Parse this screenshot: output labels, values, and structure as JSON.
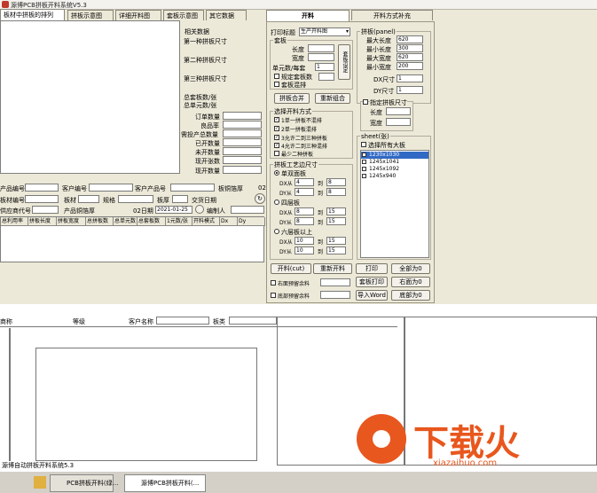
{
  "window": {
    "title": "源博PCB拼板开料系统V5.3"
  },
  "left_tabs": [
    "板材中拼板的排列",
    "拼板示意图",
    "详细开料图",
    "套板示意图",
    "其它数据"
  ],
  "related": {
    "title": "相关数据",
    "first": "第一种拼板尺寸",
    "second": "第二种拼板尺寸",
    "third": "第三种拼板尺寸",
    "total_sets": "总套板数/张",
    "total_units": "总单元数/张",
    "rows": [
      "订单数量",
      "良品率",
      "需投产总数量",
      "已开数量",
      "未开数量",
      "现开张数",
      "现开数量"
    ]
  },
  "info": {
    "product_no": "产品编号",
    "customer_no": "客户编号",
    "customer_product": "客户产品号",
    "board_thick": "板铜箔厚",
    "material_no": "板材编号",
    "material": "板材",
    "spec": "规格",
    "board_thick2": "板厚",
    "delivery": "交货日期",
    "supplier": "供应商代号",
    "product_foil": "产品铜箔厚",
    "date_label": "02日期",
    "date": "2021-01-25",
    "editor": "编制人",
    "val_02": "02"
  },
  "table_headers": [
    "总利用率",
    "拼板长度",
    "拼板宽度",
    "总拼板数",
    "总单元数",
    "总套板数",
    "1元数/张",
    "开料模式",
    "Dx",
    "Dy"
  ],
  "right_tabs": {
    "cut": "开料",
    "method": "开料方式补充"
  },
  "print_label": "打印标题",
  "print_value": "生产开料图",
  "set": {
    "title": "套板",
    "length": "长度",
    "width": "宽度",
    "units_label": "单元数/每套",
    "units": "1",
    "fixed_count": "规定套板数",
    "mixed": "套板混排",
    "side_btn": "套板设定",
    "merge": "拼板合并",
    "recombine": "重新组合"
  },
  "method": {
    "title": "选择开料方式",
    "opts": [
      "1单一拼板不混排",
      "2单一拼板混排",
      "3允许二到三种拼板",
      "4允许二到三种混排",
      "最少二种拼板"
    ]
  },
  "edge": {
    "title": "拼板工艺边尺寸",
    "two": "单双面板",
    "four": "四层板",
    "six": "六层板以上",
    "dx": "DX从",
    "dy": "DY从",
    "to": "到",
    "vals": [
      [
        "4",
        "8"
      ],
      [
        "4",
        "8"
      ],
      [
        "8",
        "15"
      ],
      [
        "8",
        "15"
      ],
      [
        "10",
        "15"
      ],
      [
        "10",
        "15"
      ]
    ]
  },
  "panel": {
    "title": "拼板(panel)",
    "max_len": "最大长度",
    "min_len": "最小长度",
    "max_wid": "最大宽度",
    "min_wid": "最小宽度",
    "dx": "DX尺寸",
    "dy": "DY尺寸",
    "vals": [
      "620",
      "300",
      "620",
      "200",
      "1",
      "1"
    ],
    "fixed": "指定拼板尺寸",
    "len": "长度",
    "wid": "宽度"
  },
  "sheet": {
    "title": "sheet(张)",
    "all": "选择所有大板",
    "items": [
      "1230x1030",
      "1245x1041",
      "1245x1092",
      "1245x940"
    ]
  },
  "buttons": {
    "cut": "开料(cut)",
    "recut": "重新开料",
    "print": "打印",
    "all_to": "全部为0",
    "print_set": "套板打印",
    "right_to": "右面为0",
    "export": "导入Word",
    "bottom_to": "底部为0",
    "right_keep": "右面预留余料",
    "bottom_keep": "底部预留余料"
  },
  "lower": {
    "name": "商称",
    "grade": "等级",
    "customer_name": "客户名称",
    "board_type": "板类"
  },
  "status": "源博自动拼板开料系统5.3",
  "taskbar": {
    "t1": "PCB拼板开料(绿...",
    "t2": "源博PCB拼板开料(..."
  },
  "watermark": {
    "text": "下载火",
    "url": "xiazaihuo.com"
  }
}
